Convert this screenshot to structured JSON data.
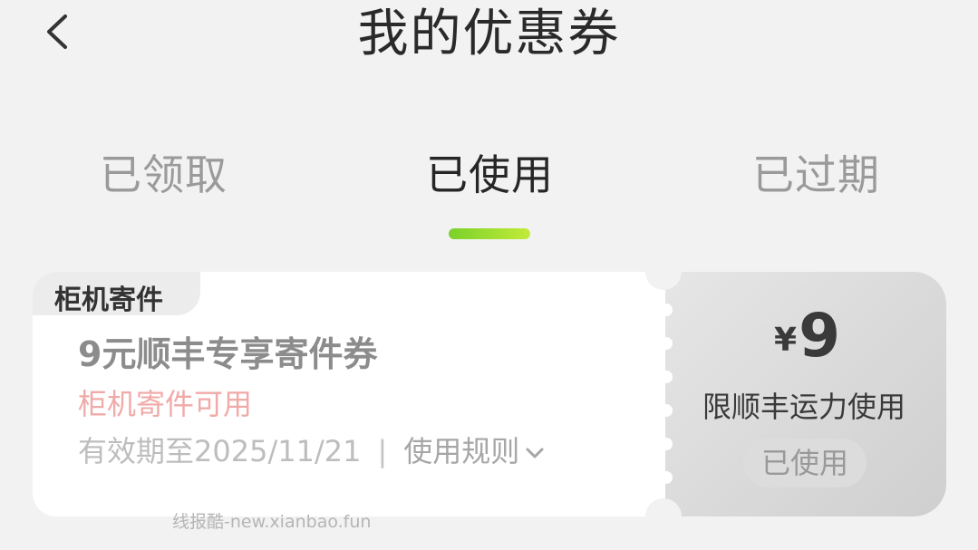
{
  "header": {
    "title": "我的优惠券"
  },
  "tabs": [
    {
      "label": "已领取",
      "active": false
    },
    {
      "label": "已使用",
      "active": true
    },
    {
      "label": "已过期",
      "active": false
    }
  ],
  "coupon": {
    "tag": "柜机寄件",
    "title": "9元顺丰专享寄件券",
    "subtitle": "柜机寄件可用",
    "validity": "有效期至2025/11/21",
    "separator": "|",
    "rules_label": "使用规则",
    "currency": "¥",
    "amount": "9",
    "limit": "限顺丰运力使用",
    "status": "已使用"
  },
  "watermark": "线报酷-new.xianbao.fun",
  "colors": {
    "accent_start": "#7ad12a",
    "accent_end": "#c2eb3a",
    "subtitle": "#f0aaa8"
  },
  "icons": {
    "back": "chevron-left-icon",
    "rules": "chevron-down-icon"
  }
}
